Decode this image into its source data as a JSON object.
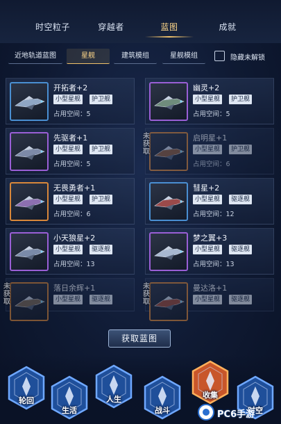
{
  "top_tabs": [
    "时空粒子",
    "穿越者",
    "蓝图",
    "成就"
  ],
  "active_top_tab": "蓝图",
  "sub_tabs": [
    "近地轨道蓝图",
    "星舰",
    "建筑模组",
    "星舰模组"
  ],
  "active_sub_tab": "星舰",
  "hide_unlocked_label": "隐藏未解锁",
  "not_obtained_label": "未获取",
  "ships": [
    {
      "name": "开拓者+2",
      "size": "小型星舰",
      "role": "护卫舰",
      "space": "占用空间：5",
      "rarity": "blue",
      "obtained": true
    },
    {
      "name": "幽灵+2",
      "size": "小型星舰",
      "role": "护卫舰",
      "space": "占用空间：5",
      "rarity": "purple",
      "obtained": true
    },
    {
      "name": "先驱者+1",
      "size": "小型星舰",
      "role": "护卫舰",
      "space": "占用空间：5",
      "rarity": "purple",
      "obtained": true
    },
    {
      "name": "启明星+1",
      "size": "小型星舰",
      "role": "护卫舰",
      "space": "占用空间：6",
      "rarity": "orange",
      "obtained": false
    },
    {
      "name": "无畏勇者+1",
      "size": "小型星舰",
      "role": "护卫舰",
      "space": "占用空间：6",
      "rarity": "orange",
      "obtained": true
    },
    {
      "name": "彗星+2",
      "size": "小型星舰",
      "role": "驱逐舰",
      "space": "占用空间：12",
      "rarity": "blue",
      "obtained": true
    },
    {
      "name": "小天狼星+2",
      "size": "小型星舰",
      "role": "驱逐舰",
      "space": "占用空间：13",
      "rarity": "purple",
      "obtained": true
    },
    {
      "name": "梦之翼+3",
      "size": "小型星舰",
      "role": "驱逐舰",
      "space": "占用空间：13",
      "rarity": "purple",
      "obtained": true
    },
    {
      "name": "落日余辉+1",
      "size": "小型星舰",
      "role": "驱逐舰",
      "space": "",
      "rarity": "orange",
      "obtained": false
    },
    {
      "name": "曼达洛+1",
      "size": "小型星舰",
      "role": "驱逐舰",
      "space": "",
      "rarity": "orange",
      "obtained": false
    }
  ],
  "get_blueprint_button": "获取蓝图",
  "bottom_nav": [
    {
      "label": "轮回",
      "icon": "rebirth-icon"
    },
    {
      "label": "生活",
      "icon": "life-icon"
    },
    {
      "label": "人生",
      "icon": "person-icon"
    },
    {
      "label": "战斗",
      "icon": "battle-icon"
    },
    {
      "label": "收集",
      "icon": "collection-icon",
      "active": true
    },
    {
      "label": "时空",
      "icon": "spacetime-icon"
    }
  ],
  "watermark": "PC6手游",
  "colors": {
    "accent_gold": "#f0c26b",
    "rarity_blue": "#4a8fd2",
    "rarity_purple": "#9a5fd6",
    "rarity_orange": "#d8873a",
    "active_nav": "#e07a2c"
  }
}
